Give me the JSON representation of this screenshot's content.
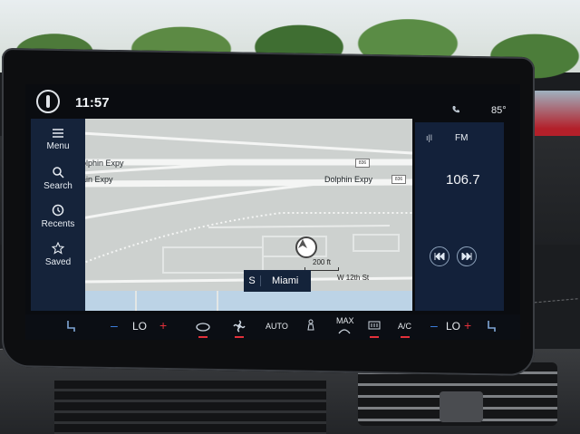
{
  "status": {
    "time": "11:57",
    "temperature": "85°",
    "phone_icon": "phone-icon"
  },
  "nav": {
    "items": [
      {
        "label": "Menu",
        "icon": "menu-icon"
      },
      {
        "label": "Search",
        "icon": "search-icon"
      },
      {
        "label": "Recents",
        "icon": "clock-icon"
      },
      {
        "label": "Saved",
        "icon": "star-icon"
      }
    ]
  },
  "map": {
    "roads": [
      "Dolphin Expy",
      "Dolphin Expy"
    ],
    "road_label_left_top": "olphin Expy",
    "road_label_left_bottom": "ain Expy",
    "road_label_center": "Dolphin Expy",
    "shields": [
      "836",
      "836"
    ],
    "scale_text": "200 ft",
    "street": "W 12th St",
    "heading_direction": "S",
    "heading_city": "Miami"
  },
  "radio": {
    "band": "FM",
    "signal": "ı|l",
    "frequency": "106.7",
    "prev_icon": "seek-back-icon",
    "next_icon": "seek-forward-icon"
  },
  "climate": {
    "left_minus": "–",
    "left_temp": "LO",
    "left_plus": "+",
    "auto": "AUTO",
    "max": "MAX",
    "ac": "A/C",
    "right_minus": "–",
    "right_temp": "LO",
    "right_plus": "+"
  },
  "colors": {
    "panel": "#15233a",
    "accent_red": "#e2303a",
    "accent_blue": "#3f84e8",
    "map_bg": "#cdd1cf"
  }
}
